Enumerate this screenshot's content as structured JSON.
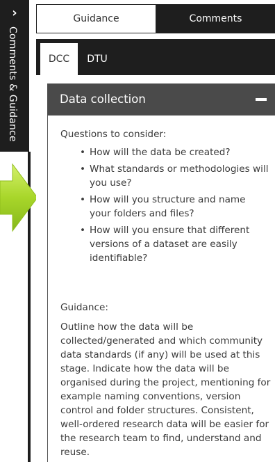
{
  "sidebar": {
    "toggle_icon": "chevron-right-icon",
    "label": "Comments & Guidance"
  },
  "top_tabs": [
    {
      "label": "Guidance",
      "active": true
    },
    {
      "label": "Comments",
      "active": false
    }
  ],
  "sub_tabs": [
    {
      "label": "DCC",
      "active": true
    },
    {
      "label": "DTU",
      "active": false
    }
  ],
  "section": {
    "title": "Data collection",
    "collapse_icon": "minus-icon",
    "questions_heading": "Questions to consider:",
    "questions": [
      "How will the data be created?",
      "What standards or methodologies will you use?",
      "How will you structure and name your folders and files?",
      "How will you ensure that different versions of a dataset are easily identifiable?"
    ],
    "guidance_heading": "Guidance:",
    "guidance_text": "Outline how the data will be collected/generated and which community data standards (if any) will be used at this stage. Indicate how the data will be organised during the project, mentioning for example naming conventions, version control and folder structures. Consistent, well-ordered research data will be easier for the research team to find, understand and reuse."
  },
  "colors": {
    "dark": "#1e1e1e",
    "section_header": "#4a4a4a",
    "arrow_green": "#9ccc1f"
  }
}
